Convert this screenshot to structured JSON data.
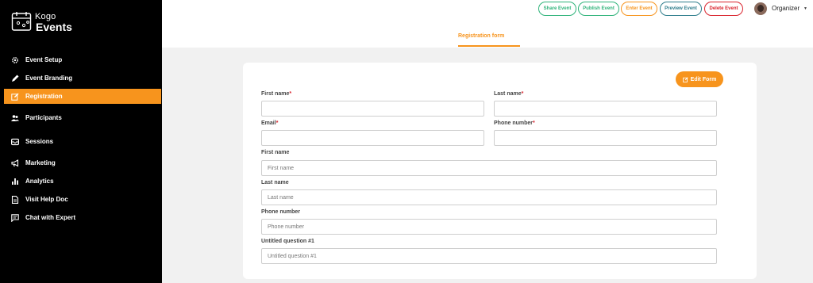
{
  "brand": {
    "line1": "Kogo",
    "line2": "Events"
  },
  "accent": "#f7941d",
  "sidebar": {
    "items": [
      {
        "label": "Event Setup",
        "icon": "gear-icon"
      },
      {
        "label": "Event Branding",
        "icon": "pencil-icon"
      },
      {
        "label": "Registration",
        "icon": "edit-icon",
        "active": true
      },
      {
        "label": "Participants",
        "icon": "users-icon"
      },
      {
        "label": "Sessions",
        "icon": "inbox-icon"
      },
      {
        "label": "Marketing",
        "icon": "megaphone-icon"
      },
      {
        "label": "Analytics",
        "icon": "bar-chart-icon"
      },
      {
        "label": "Visit Help Doc",
        "icon": "document-icon"
      },
      {
        "label": "Chat with Expert",
        "icon": "chat-icon"
      }
    ]
  },
  "topbar": {
    "buttons": [
      {
        "label": "Share Event",
        "color": "#2fb37a"
      },
      {
        "label": "Publish Event",
        "color": "#2fb37a"
      },
      {
        "label": "Enter Event",
        "color": "#f7941d"
      },
      {
        "label": "Preview Event",
        "color": "#2e7d8c"
      },
      {
        "label": "Delete Event",
        "color": "#d9232d"
      }
    ],
    "user": "Organizer"
  },
  "tabs": {
    "active": "Registration form"
  },
  "form": {
    "edit_button": "Edit Form",
    "fields": {
      "first_name_req": {
        "label": "First name",
        "value": ""
      },
      "last_name_req": {
        "label": "Last name",
        "value": ""
      },
      "email_req": {
        "label": "Email",
        "value": ""
      },
      "phone_req": {
        "label": "Phone number",
        "value": ""
      },
      "first_name": {
        "label": "First name",
        "placeholder": "First name"
      },
      "last_name": {
        "label": "Last name",
        "placeholder": "Last name"
      },
      "phone": {
        "label": "Phone number",
        "placeholder": "Phone number"
      },
      "untitled": {
        "label": "Untitled question #1",
        "placeholder": "Untitled question #1"
      }
    },
    "required_mark": "*"
  }
}
